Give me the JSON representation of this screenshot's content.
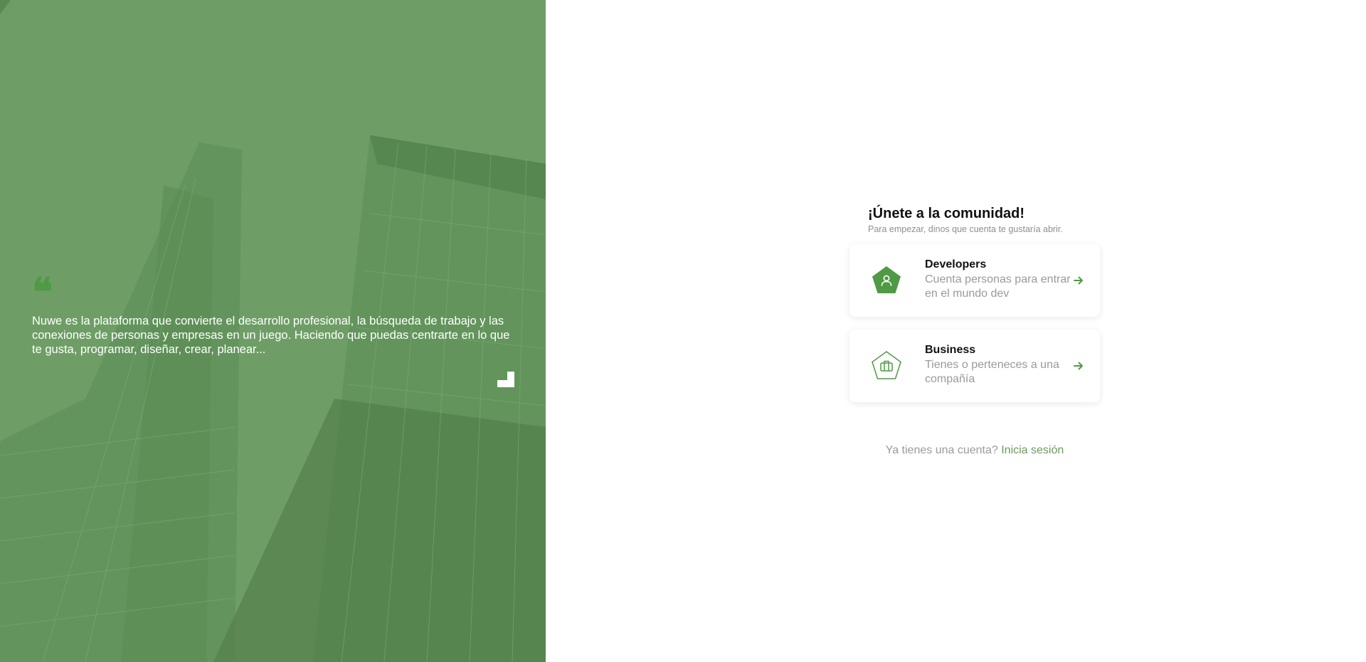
{
  "hero": {
    "quote_mark": "❝",
    "quote_text": "Nuwe es la plataforma que convierte el desarrollo profesional, la búsqueda de trabajo y las conexiones de personas y empresas en un juego. Haciendo que puedas centrarte en lo que te gusta, programar, diseñar, crear, planear..."
  },
  "join": {
    "title": "¡Únete a la comunidad!",
    "subtitle": "Para empezar, dinos que cuenta te gustaría abrir.",
    "options": [
      {
        "name": "Developers",
        "description": "Cuenta personas para entrar en el mundo dev",
        "icon": "user-pentagon-icon"
      },
      {
        "name": "Business",
        "description": "Tienes o perteneces a una compañía",
        "icon": "briefcase-pentagon-icon"
      }
    ]
  },
  "login": {
    "prompt": "Ya tienes una cuenta?",
    "link_label": "Inicia sesión"
  },
  "colors": {
    "hero_green": "#6e9e66",
    "accent_green": "#4f9a45",
    "link_green": "#6a9a5e"
  }
}
